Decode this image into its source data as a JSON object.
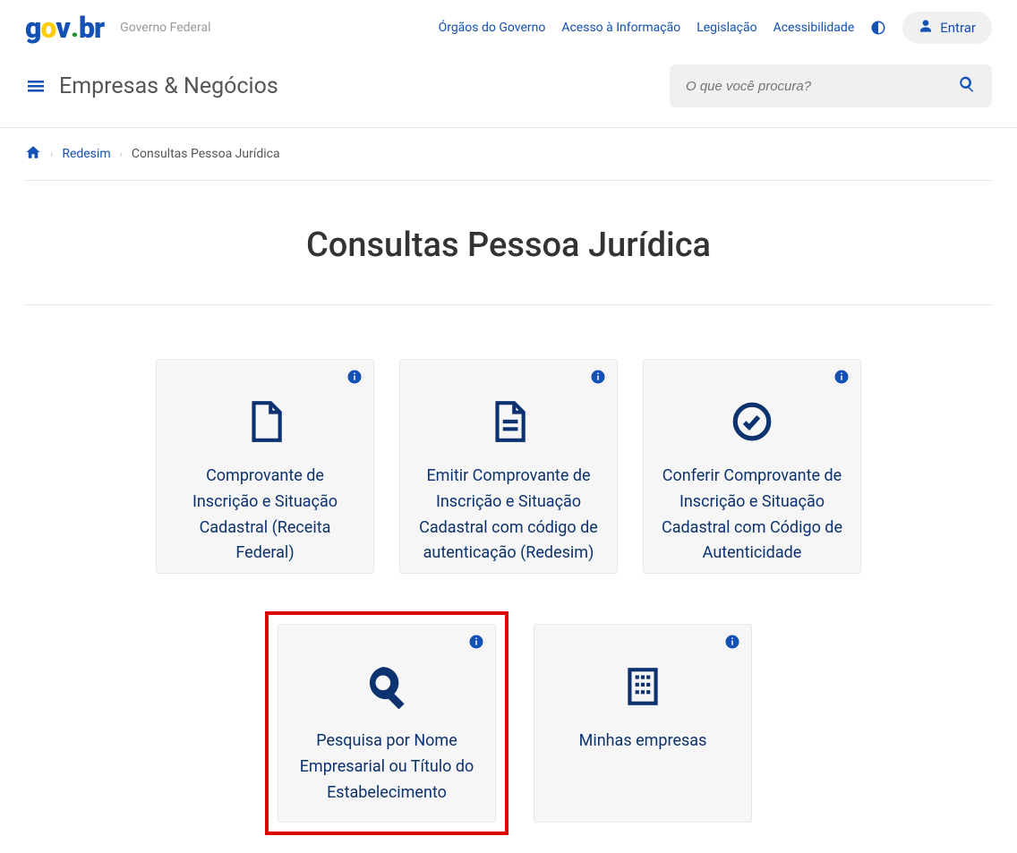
{
  "header": {
    "logo_text": "gov.br",
    "logo_sub": "Governo Federal",
    "links": [
      "Órgãos do Governo",
      "Acesso à Informação",
      "Legislação",
      "Acessibilidade"
    ],
    "sign_in": "Entrar"
  },
  "nav": {
    "site_name": "Empresas & Negócios",
    "search_placeholder": "O que você procura?"
  },
  "breadcrumb": {
    "redesim": "Redesim",
    "current": "Consultas Pessoa Jurídica"
  },
  "page_title": "Consultas Pessoa Jurídica",
  "cards": [
    {
      "title": "Comprovante de Inscrição e Situação Cadastral (Receita Federal)"
    },
    {
      "title": "Emitir Comprovante de Inscrição e Situação Cadastral com código de autenticação (Redesim)"
    },
    {
      "title": "Conferir Comprovante de Inscrição e Situação Cadastral com Código de Autenticidade"
    },
    {
      "title": "Pesquisa por Nome Empresarial ou Título do Estabelecimento"
    },
    {
      "title": "Minhas empresas"
    }
  ]
}
